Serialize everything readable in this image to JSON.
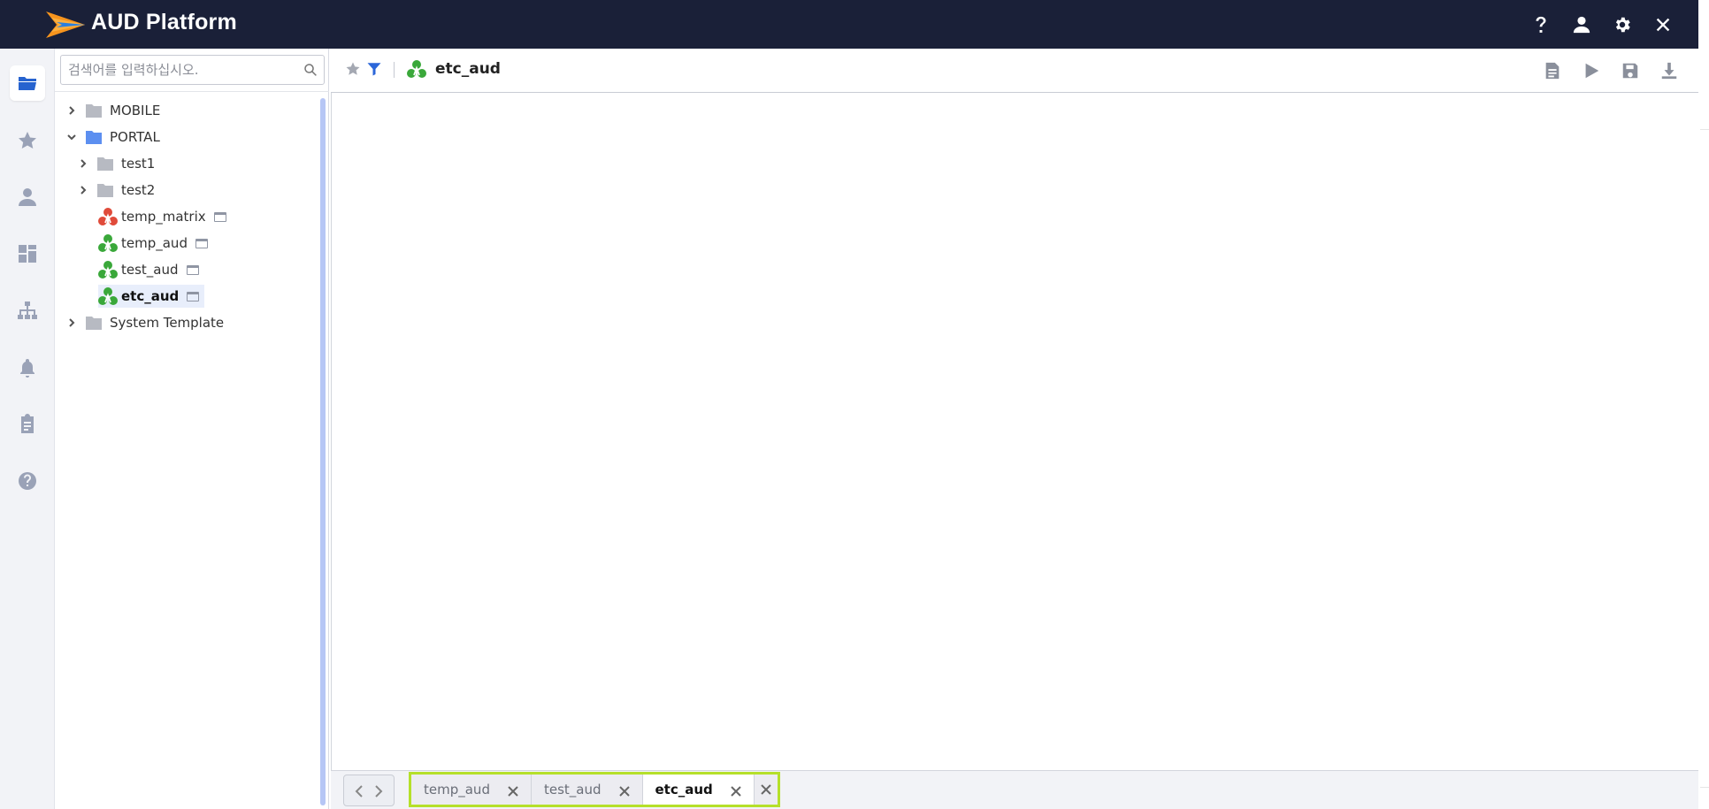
{
  "header": {
    "app_title": "AUD Platform",
    "icons": [
      "help-icon",
      "user-icon",
      "settings-icon",
      "close-icon"
    ]
  },
  "rail": {
    "items": [
      "folder-icon",
      "star-icon",
      "user-icon",
      "dashboard-icon",
      "sitemap-icon",
      "bell-icon",
      "clipboard-icon",
      "help-circle-icon"
    ],
    "active": "folder-icon"
  },
  "tree": {
    "search_placeholder": "검색어를 입력하십시오.",
    "nodes": [
      {
        "label": "MOBILE",
        "type": "folder",
        "expanded": false
      },
      {
        "label": "PORTAL",
        "type": "folder",
        "expanded": true
      },
      {
        "label": "test1",
        "type": "folder",
        "expanded": false
      },
      {
        "label": "test2",
        "type": "folder",
        "expanded": false
      },
      {
        "label": "temp_matrix",
        "type": "matrix-report"
      },
      {
        "label": "temp_aud",
        "type": "aud-report"
      },
      {
        "label": "test_aud",
        "type": "aud-report"
      },
      {
        "label": "etc_aud",
        "type": "aud-report",
        "selected": true
      },
      {
        "label": "System Template",
        "type": "folder",
        "expanded": false
      }
    ]
  },
  "content": {
    "title": "etc_aud",
    "actions": [
      "document-icon",
      "play-icon",
      "save-icon",
      "download-icon"
    ]
  },
  "tabs": {
    "items": [
      {
        "label": "temp_aud",
        "active": false
      },
      {
        "label": "test_aud",
        "active": false
      },
      {
        "label": "etc_aud",
        "active": true
      }
    ]
  },
  "colors": {
    "header_bg": "#1a2038",
    "accent": "#2763cf",
    "highlight_border": "#b5e02a",
    "aud_icon": "#3aa83a",
    "matrix_icon": "#e04b3a"
  }
}
